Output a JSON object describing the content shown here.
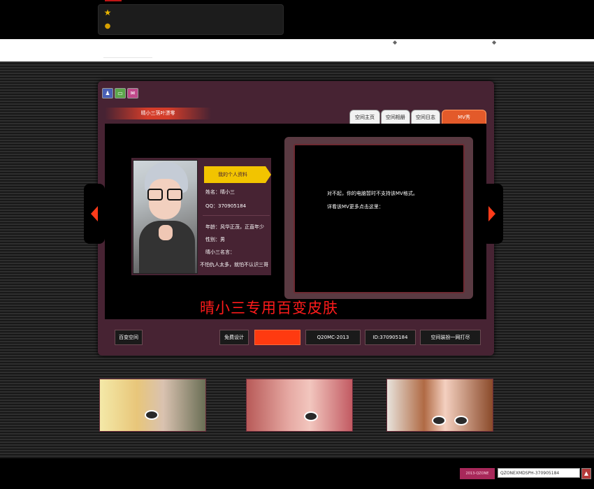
{
  "header": {
    "icons": [
      "star-icon",
      "user-icon"
    ]
  },
  "window": {
    "control_icons": [
      "person-icon",
      "window-icon",
      "mail-icon"
    ],
    "title": "晴小三落叶漂零"
  },
  "tabs": [
    {
      "label": "空间主页",
      "active": false
    },
    {
      "label": "空间相册",
      "active": false
    },
    {
      "label": "空间日志",
      "active": false
    },
    {
      "label": "MV秀",
      "active": true
    }
  ],
  "profile": {
    "section_label": "我的个人资料",
    "name_line": "姓名：晴小三",
    "qq_line": "QQ：370905184",
    "age_line": "年龄：风华正茂，正直年少",
    "gender_line": "性别：男",
    "motto_title": "晴小三名言：",
    "motto_text": "不怕仇人太多，就怕不认识三哥"
  },
  "player": {
    "line1": "对不起，你的电脑暂时不支持该MV格式。",
    "line2": "详看该MV更多点击这里："
  },
  "banner_text": "晴小三专用百变皮肤",
  "bottom_buttons": {
    "left": "百变空间",
    "b1": "免费设计",
    "b2": "",
    "b3": "Q20MC-2013",
    "b4": "ID:370905184",
    "b5": "空间装扮一网打尽"
  },
  "footer": {
    "button_label": "2013-QZONE",
    "input_value": "QZONEXMDSPH-370905184",
    "go_icon": "up-arrow-icon"
  },
  "colors": {
    "accent": "#ff3a10",
    "panel": "#472333",
    "label_yellow": "#f2c400",
    "banner_red": "#ff1b1b"
  }
}
